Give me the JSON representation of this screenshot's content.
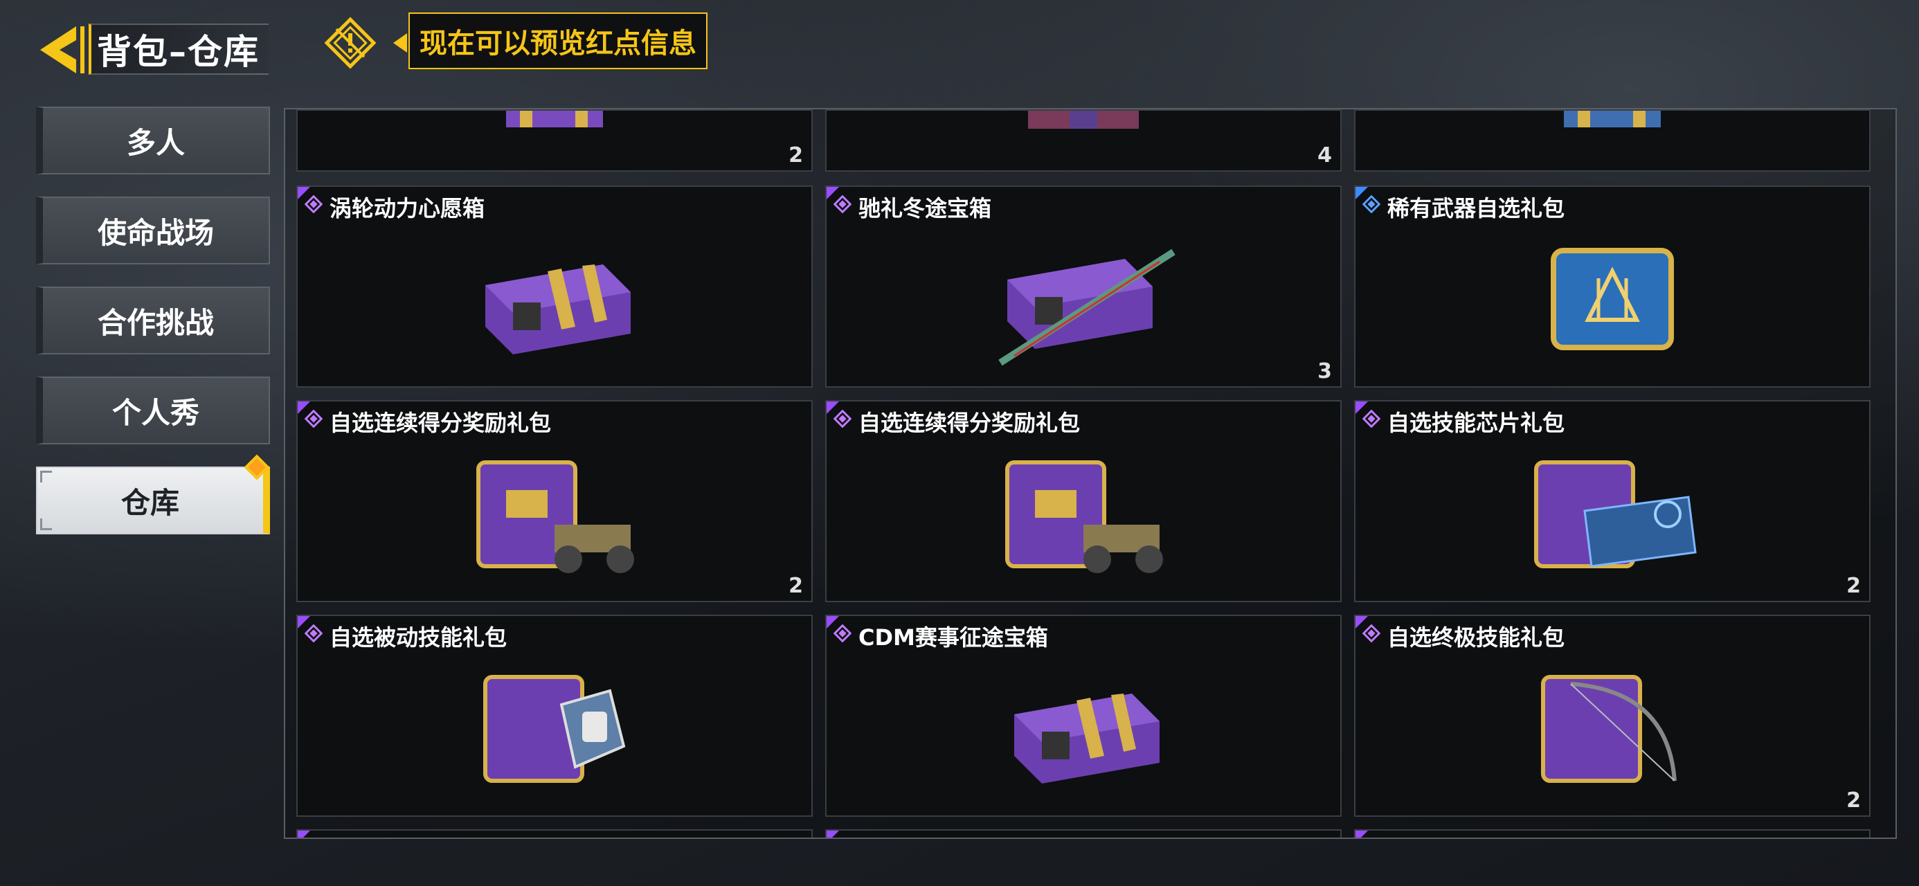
{
  "header": {
    "title": "背包–仓库",
    "tip_text": "现在可以预览红点信息",
    "back_icon": "back-arrow-icon",
    "red_dot_toggle_icon": "hide-reddot-icon"
  },
  "sidebar": {
    "items": [
      {
        "label": "多人"
      },
      {
        "label": "使命战场"
      },
      {
        "label": "合作挑战"
      },
      {
        "label": "个人秀"
      },
      {
        "label": "仓库"
      }
    ],
    "active_index": 4
  },
  "colors": {
    "accent": "#f5c518",
    "epic": "#9a4cff",
    "rare": "#3c8cff",
    "crate": "#7a4bbf"
  },
  "grid": {
    "top_row_counts": [
      "2",
      "4",
      ""
    ],
    "items": [
      {
        "name": "涡轮动力心愿箱",
        "rarity": "epic",
        "count": "",
        "icon": "purple-crate-icon"
      },
      {
        "name": "驰礼冬途宝箱",
        "rarity": "epic",
        "count": "3",
        "icon": "purple-crate-rifle-icon"
      },
      {
        "name": "稀有武器自选礼包",
        "rarity": "rare",
        "count": "",
        "icon": "blue-weapon-case-icon"
      },
      {
        "name": "自选连续得分奖励礼包",
        "rarity": "epic",
        "count": "2",
        "icon": "crate-buggy-icon"
      },
      {
        "name": "自选连续得分奖励礼包",
        "rarity": "epic",
        "count": "",
        "icon": "crate-buggy-icon"
      },
      {
        "name": "自选技能芯片礼包",
        "rarity": "epic",
        "count": "2",
        "icon": "crate-chip-icon"
      },
      {
        "name": "自选被动技能礼包",
        "rarity": "epic",
        "count": "",
        "icon": "crate-fist-icon"
      },
      {
        "name": "CDM赛事征途宝箱",
        "rarity": "epic",
        "count": "",
        "icon": "purple-crate-icon"
      },
      {
        "name": "自选终极技能礼包",
        "rarity": "epic",
        "count": "2",
        "icon": "crate-bow-icon"
      }
    ]
  }
}
